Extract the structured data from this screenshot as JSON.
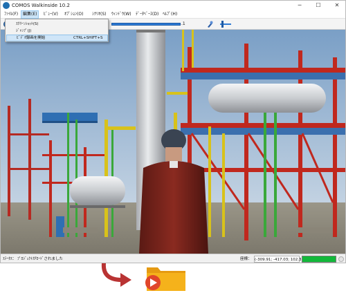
{
  "window": {
    "title": "COMOS Walkinside 10.2",
    "minimize": "─",
    "maximize": "☐",
    "close": "✕"
  },
  "menubar": {
    "items": [
      {
        "label": "ﾌｧｲﾙ(F)"
      },
      {
        "label": "編集(E)"
      },
      {
        "label": "ﾋﾞｭｰ(V)"
      },
      {
        "label": "ｵﾌﾟｼｮﾝ(O)"
      },
      {
        "label": "ｼﾅﾘｵ(S)"
      },
      {
        "label": "ｳｨﾝﾄﾞｳ(W)"
      },
      {
        "label": "ﾃﾞｰﾀﾍﾞｰｽ(D)"
      },
      {
        "label": "ﾍﾙﾌﾟ(H)"
      }
    ],
    "active_index": 1
  },
  "dropdown": {
    "items": [
      {
        "label": "ｽｸﾘｰﾝｼｮｯﾄ(S)",
        "shortcut": ""
      },
      {
        "label": "ｼﾞｬﾝﾌﾟ(J)",
        "shortcut": ""
      },
      {
        "label": "ﾋﾞﾃﾞｵ録画を開始",
        "shortcut": "CTRL+SHIFT+S"
      }
    ],
    "highlighted_index": 2
  },
  "toolbar": {
    "value_suffix": ".1"
  },
  "statusbar": {
    "status_text": "ｽﾃｰﾀｽ： ﾌﾟﾛｼﾞｪｸﾄがﾛｰﾄﾞされました",
    "coord_label": "座標：",
    "coord_value": "(-309.91; -417.03; 102.31)",
    "progress_percent": 100
  },
  "colors": {
    "accent": "#2e7bd6",
    "menu_highlight": "#cce4f7",
    "progress": "#12b83a",
    "steel_red": "#c0281e",
    "pipe_yellow": "#d8c21a",
    "pipe_green": "#3aa83a",
    "folder": "#f5b21b",
    "record_red": "#e0462b",
    "arrow_red": "#b93333"
  },
  "icons": [
    "app-icon",
    "toolbar-globe-icon",
    "toolbar-tool-icon",
    "arrow-icon",
    "video-folder-icon",
    "play-icon"
  ]
}
